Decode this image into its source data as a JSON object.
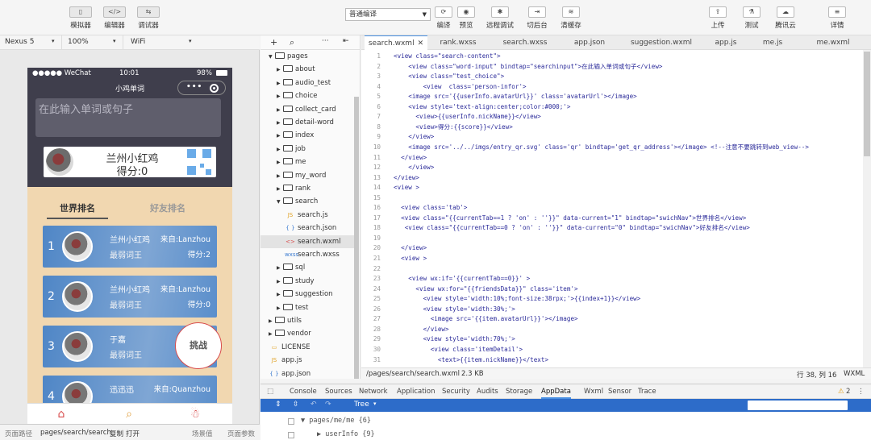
{
  "toolbar": {
    "left_buttons": [
      {
        "label": "模拟器",
        "glyph": "▯"
      },
      {
        "label": "编辑器",
        "glyph": "</>"
      },
      {
        "label": "调试器",
        "glyph": "⇆"
      }
    ],
    "mode": "普通编译",
    "center_buttons": [
      {
        "label": "编译",
        "glyph": "⟳"
      },
      {
        "label": "预览",
        "glyph": "◉"
      },
      {
        "label": "远程调试",
        "glyph": "✱"
      },
      {
        "label": "切后台",
        "glyph": "⇥"
      },
      {
        "label": "清缓存",
        "glyph": "≋"
      }
    ],
    "right_buttons": [
      {
        "label": "上传",
        "glyph": "⇪"
      },
      {
        "label": "测试",
        "glyph": "⚗"
      },
      {
        "label": "腾讯云",
        "glyph": "☁"
      },
      {
        "label": "详情",
        "glyph": "≡"
      }
    ]
  },
  "device": {
    "model": "Nexus 5",
    "zoom": "100%",
    "network": "WiFi"
  },
  "phone": {
    "carrier": "●●●●● WeChat",
    "time": "10:01",
    "battery": "98%",
    "title": "小鸡单词",
    "capsule_dots": "•••",
    "input_placeholder": "在此输入单词或句子",
    "user_name": "兰州小红鸡",
    "user_score": "得分:0",
    "tabs": {
      "world": "世界排名",
      "friends": "好友排名"
    },
    "ranks": [
      {
        "no": "1",
        "name": "兰州小红鸡",
        "from": "来自:Lanzhou",
        "level": "最弱词王",
        "score": "得分:2"
      },
      {
        "no": "2",
        "name": "兰州小红鸡",
        "from": "来自:Lanzhou",
        "level": "最弱词王",
        "score": "得分:0"
      },
      {
        "no": "3",
        "name": "于嘉",
        "from": "",
        "level": "最弱词王",
        "score": ""
      },
      {
        "no": "4",
        "name": "迅迅迅",
        "from": "来自:Quanzhou",
        "level": "",
        "score": ""
      }
    ],
    "challenge": "挑战",
    "tabbar": [
      "home-icon",
      "search-icon",
      "me-icon"
    ]
  },
  "sim_footer": {
    "path_label": "页面路径",
    "path": "pages/search/search",
    "copy": "复制",
    "open": "打开",
    "scene": "场景值",
    "params": "页面参数"
  },
  "tree": [
    {
      "name": "pages",
      "type": "folder-open",
      "depth": 0
    },
    {
      "name": "about",
      "type": "folder",
      "depth": 1
    },
    {
      "name": "audio_test",
      "type": "folder",
      "depth": 1
    },
    {
      "name": "choice",
      "type": "folder",
      "depth": 1
    },
    {
      "name": "collect_card",
      "type": "folder",
      "depth": 1
    },
    {
      "name": "detail-word",
      "type": "folder",
      "depth": 1
    },
    {
      "name": "index",
      "type": "folder",
      "depth": 1
    },
    {
      "name": "job",
      "type": "folder",
      "depth": 1
    },
    {
      "name": "me",
      "type": "folder",
      "depth": 1
    },
    {
      "name": "my_word",
      "type": "folder",
      "depth": 1
    },
    {
      "name": "rank",
      "type": "folder",
      "depth": 1
    },
    {
      "name": "search",
      "type": "folder-open",
      "depth": 1
    },
    {
      "name": "search.js",
      "type": "js",
      "depth": 2
    },
    {
      "name": "search.json",
      "type": "json",
      "depth": 2
    },
    {
      "name": "search.wxml",
      "type": "wxml",
      "depth": 2
    },
    {
      "name": "search.wxss",
      "type": "wxss",
      "depth": 2
    },
    {
      "name": "sql",
      "type": "folder",
      "depth": 1
    },
    {
      "name": "study",
      "type": "folder",
      "depth": 1
    },
    {
      "name": "suggestion",
      "type": "folder",
      "depth": 1
    },
    {
      "name": "test",
      "type": "folder",
      "depth": 1
    },
    {
      "name": "utils",
      "type": "folder",
      "depth": 0
    },
    {
      "name": "vendor",
      "type": "folder",
      "depth": 0
    },
    {
      "name": "LICENSE",
      "type": "file",
      "depth": 0
    },
    {
      "name": "app.js",
      "type": "js",
      "depth": 0
    },
    {
      "name": "app.json",
      "type": "json",
      "depth": 0
    }
  ],
  "editor_tabs": [
    "search.wxml",
    "rank.wxss",
    "search.wxss",
    "app.json",
    "suggestion.wxml",
    "app.js",
    "me.js",
    "me.wxml"
  ],
  "code": [
    "<view class=\"search-content\">",
    "    <view class=\"word-input\" bindtap=\"searchinput\">在此输入单词或句子</view>",
    "    <view class=\"test_choice\">",
    "        <view  class='person-infor'>",
    "    <image src='{{userInfo.avatarUrl}}' class='avatarUrl'></image>",
    "    <view style='text-align:center;color:#000;'>",
    "      <view>{{userInfo.nickName}}</view>",
    "      <view>得分:{{score}}</view>",
    "    </view>",
    "    <image src='../../imgs/entry_qr.svg' class='qr' bindtap='get_qr_address'></image> <!--注意不要跳转到web_view-->",
    "  </view>",
    "    </view>",
    "</view>",
    "<view >",
    "",
    "  <view class='tab'>",
    "  <view class=\"{{currentTab==1 ? 'on' : ''}}\" data-current=\"1\" bindtap=\"swichNav\">世界排名</view>",
    "   <view class=\"{{currentTab==0 ? 'on' : ''}}\" data-current=\"0\" bindtap=\"swichNav\">好友排名</view>",
    "",
    "  </view>",
    "  <view >",
    "",
    "    <view wx:if='{{currentTab==0}}' >",
    "      <view wx:for=\"{{friendsData}}\" class='item'>",
    "        <view style='width:10%;font-size:38rpx;'>{{index+1}}</view>",
    "        <view style='width:30%;'>",
    "          <image src='{{item.avatarUrl}}'></image>",
    "        </view>",
    "        <view style='width:70%;'>",
    "          <view class='itemDetail'>",
    "            <text>{{item.nickName}}</text>"
  ],
  "editor_status": {
    "path": "/pages/search/search.wxml",
    "size": "2.3 KB",
    "pos": "行 38, 列 16",
    "lang": "WXML"
  },
  "devtools": {
    "tabs": [
      "Console",
      "Sources",
      "Network",
      "Application",
      "Security",
      "Audits",
      "Storage",
      "AppData",
      "Wxml",
      "Sensor",
      "Trace"
    ],
    "active_tab": "AppData",
    "warning_count": "2",
    "view_mode": "Tree",
    "rows": [
      "▼ pages/me/me {6}",
      "▶ userInfo {9}"
    ]
  },
  "colors": {
    "dark": "#3f3e4c",
    "rank_blue": "#4f86c6",
    "beige": "#f1d7b0",
    "accent": "#4a90e2"
  }
}
